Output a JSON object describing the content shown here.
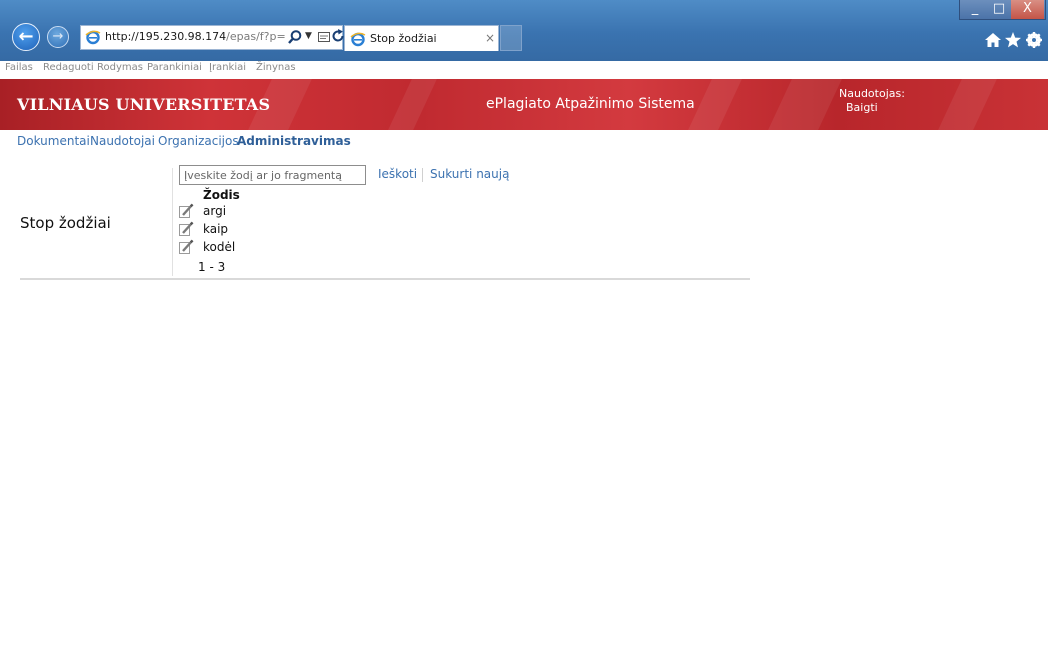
{
  "browser": {
    "url_main": "http://195.230.98.174",
    "url_path": "/epas/f?p=",
    "tab_title": "Stop žodžiai",
    "tab_close": "×",
    "back_glyph": "←",
    "forward_glyph": "→",
    "window_controls": {
      "minimize": "_",
      "maximize": "□",
      "close": "X"
    }
  },
  "menu": [
    "Failas",
    "Redaguoti",
    "Rodymas",
    "Parankiniai",
    "Įrankiai",
    "Žinynas"
  ],
  "header": {
    "university": "VILNIAUS UNIVERSITETAS",
    "system": "ePlagiato Atpažinimo Sistema",
    "user_label": "Naudotojas:",
    "logout": "Baigti"
  },
  "nav": {
    "items": [
      {
        "label": "Dokumentai",
        "active": false
      },
      {
        "label": "Naudotojai",
        "active": false
      },
      {
        "label": "Organizacijos",
        "active": false
      },
      {
        "label": "Administravimas",
        "active": true
      }
    ]
  },
  "content": {
    "title": "Stop žodžiai",
    "search_placeholder": "Įveskite žodį ar jo fragmentą",
    "search_link": "Ieškoti",
    "create_link": "Sukurti naują",
    "column_header": "Žodis",
    "rows": [
      {
        "word": "argi"
      },
      {
        "word": "kaip"
      },
      {
        "word": "kodėl"
      }
    ],
    "pagination": "1 - 3"
  },
  "icons": {
    "browser_logo": "ie-logo-icon",
    "edit": "edit-pencil-icon",
    "toolbar": [
      "home-icon",
      "star-icon",
      "gear-icon"
    ]
  },
  "colors": {
    "header_red": "#c42b30",
    "link_blue": "#3c72b0",
    "chrome_blue": "#3a73b0"
  }
}
